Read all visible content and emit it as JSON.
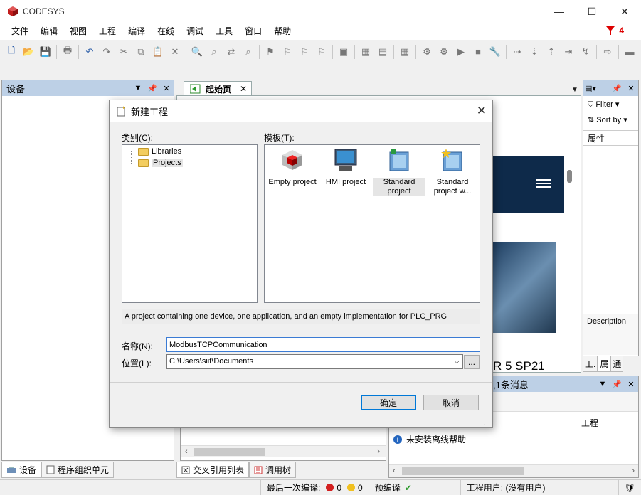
{
  "window": {
    "title": "CODESYS",
    "minimize": "—",
    "maximize": "☐",
    "close": "✕"
  },
  "menu": [
    "文件",
    "编辑",
    "视图",
    "工程",
    "编译",
    "在线",
    "调试",
    "工具",
    "窗口",
    "帮助"
  ],
  "messages_count": "4",
  "devices_panel": {
    "title": "设备"
  },
  "doc_tab": {
    "label": "起始页"
  },
  "properties_panel": {
    "filter": "Filter",
    "sort_by": "Sort by",
    "header": "属性",
    "description": "Description",
    "tab_property": "工.",
    "tab_props": "属",
    "tab_comm": "通"
  },
  "messages_panel": {
    "title": ",1条消息",
    "col_project": "工程",
    "message": "未安装离线帮助"
  },
  "start_page": {
    "version_text": "R 5 SP21"
  },
  "bottom_tabs_left": {
    "devices": "设备",
    "pou": "程序组织单元"
  },
  "bottom_tabs_mid": {
    "crossref": "交叉引用列表",
    "calltree": "调用树"
  },
  "status": {
    "last_build": "最后一次编译:",
    "errors": "0",
    "warnings": "0",
    "precompile": "预编译",
    "project_user": "工程用户: (没有用户)"
  },
  "dialog": {
    "title": "新建工程",
    "categories_label": "类别(C):",
    "templates_label": "模板(T):",
    "categories": [
      "Libraries",
      "Projects"
    ],
    "templates": [
      {
        "name": "Empty project"
      },
      {
        "name": "HMI project"
      },
      {
        "name": "Standard project"
      },
      {
        "name": "Standard project w..."
      }
    ],
    "description": "A project containing one device, one application, and an empty implementation for PLC_PRG",
    "name_label": "名称(N):",
    "name_value": "ModbusTCPCommunication",
    "location_label": "位置(L):",
    "location_value": "C:\\Users\\siit\\Documents",
    "browse": "...",
    "ok": "确定",
    "cancel": "取消"
  }
}
